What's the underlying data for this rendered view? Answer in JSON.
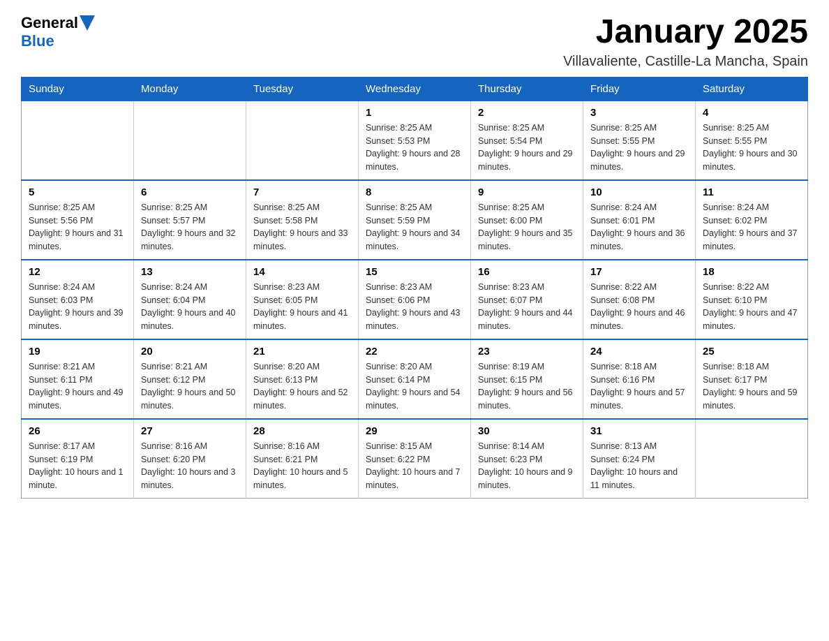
{
  "header": {
    "logo": {
      "text_general": "General",
      "text_blue": "Blue"
    },
    "title": "January 2025",
    "subtitle": "Villavaliente, Castille-La Mancha, Spain"
  },
  "calendar": {
    "days_of_week": [
      "Sunday",
      "Monday",
      "Tuesday",
      "Wednesday",
      "Thursday",
      "Friday",
      "Saturday"
    ],
    "weeks": [
      {
        "days": [
          {
            "number": "",
            "info": ""
          },
          {
            "number": "",
            "info": ""
          },
          {
            "number": "",
            "info": ""
          },
          {
            "number": "1",
            "info": "Sunrise: 8:25 AM\nSunset: 5:53 PM\nDaylight: 9 hours and 28 minutes."
          },
          {
            "number": "2",
            "info": "Sunrise: 8:25 AM\nSunset: 5:54 PM\nDaylight: 9 hours and 29 minutes."
          },
          {
            "number": "3",
            "info": "Sunrise: 8:25 AM\nSunset: 5:55 PM\nDaylight: 9 hours and 29 minutes."
          },
          {
            "number": "4",
            "info": "Sunrise: 8:25 AM\nSunset: 5:55 PM\nDaylight: 9 hours and 30 minutes."
          }
        ]
      },
      {
        "days": [
          {
            "number": "5",
            "info": "Sunrise: 8:25 AM\nSunset: 5:56 PM\nDaylight: 9 hours and 31 minutes."
          },
          {
            "number": "6",
            "info": "Sunrise: 8:25 AM\nSunset: 5:57 PM\nDaylight: 9 hours and 32 minutes."
          },
          {
            "number": "7",
            "info": "Sunrise: 8:25 AM\nSunset: 5:58 PM\nDaylight: 9 hours and 33 minutes."
          },
          {
            "number": "8",
            "info": "Sunrise: 8:25 AM\nSunset: 5:59 PM\nDaylight: 9 hours and 34 minutes."
          },
          {
            "number": "9",
            "info": "Sunrise: 8:25 AM\nSunset: 6:00 PM\nDaylight: 9 hours and 35 minutes."
          },
          {
            "number": "10",
            "info": "Sunrise: 8:24 AM\nSunset: 6:01 PM\nDaylight: 9 hours and 36 minutes."
          },
          {
            "number": "11",
            "info": "Sunrise: 8:24 AM\nSunset: 6:02 PM\nDaylight: 9 hours and 37 minutes."
          }
        ]
      },
      {
        "days": [
          {
            "number": "12",
            "info": "Sunrise: 8:24 AM\nSunset: 6:03 PM\nDaylight: 9 hours and 39 minutes."
          },
          {
            "number": "13",
            "info": "Sunrise: 8:24 AM\nSunset: 6:04 PM\nDaylight: 9 hours and 40 minutes."
          },
          {
            "number": "14",
            "info": "Sunrise: 8:23 AM\nSunset: 6:05 PM\nDaylight: 9 hours and 41 minutes."
          },
          {
            "number": "15",
            "info": "Sunrise: 8:23 AM\nSunset: 6:06 PM\nDaylight: 9 hours and 43 minutes."
          },
          {
            "number": "16",
            "info": "Sunrise: 8:23 AM\nSunset: 6:07 PM\nDaylight: 9 hours and 44 minutes."
          },
          {
            "number": "17",
            "info": "Sunrise: 8:22 AM\nSunset: 6:08 PM\nDaylight: 9 hours and 46 minutes."
          },
          {
            "number": "18",
            "info": "Sunrise: 8:22 AM\nSunset: 6:10 PM\nDaylight: 9 hours and 47 minutes."
          }
        ]
      },
      {
        "days": [
          {
            "number": "19",
            "info": "Sunrise: 8:21 AM\nSunset: 6:11 PM\nDaylight: 9 hours and 49 minutes."
          },
          {
            "number": "20",
            "info": "Sunrise: 8:21 AM\nSunset: 6:12 PM\nDaylight: 9 hours and 50 minutes."
          },
          {
            "number": "21",
            "info": "Sunrise: 8:20 AM\nSunset: 6:13 PM\nDaylight: 9 hours and 52 minutes."
          },
          {
            "number": "22",
            "info": "Sunrise: 8:20 AM\nSunset: 6:14 PM\nDaylight: 9 hours and 54 minutes."
          },
          {
            "number": "23",
            "info": "Sunrise: 8:19 AM\nSunset: 6:15 PM\nDaylight: 9 hours and 56 minutes."
          },
          {
            "number": "24",
            "info": "Sunrise: 8:18 AM\nSunset: 6:16 PM\nDaylight: 9 hours and 57 minutes."
          },
          {
            "number": "25",
            "info": "Sunrise: 8:18 AM\nSunset: 6:17 PM\nDaylight: 9 hours and 59 minutes."
          }
        ]
      },
      {
        "days": [
          {
            "number": "26",
            "info": "Sunrise: 8:17 AM\nSunset: 6:19 PM\nDaylight: 10 hours and 1 minute."
          },
          {
            "number": "27",
            "info": "Sunrise: 8:16 AM\nSunset: 6:20 PM\nDaylight: 10 hours and 3 minutes."
          },
          {
            "number": "28",
            "info": "Sunrise: 8:16 AM\nSunset: 6:21 PM\nDaylight: 10 hours and 5 minutes."
          },
          {
            "number": "29",
            "info": "Sunrise: 8:15 AM\nSunset: 6:22 PM\nDaylight: 10 hours and 7 minutes."
          },
          {
            "number": "30",
            "info": "Sunrise: 8:14 AM\nSunset: 6:23 PM\nDaylight: 10 hours and 9 minutes."
          },
          {
            "number": "31",
            "info": "Sunrise: 8:13 AM\nSunset: 6:24 PM\nDaylight: 10 hours and 11 minutes."
          },
          {
            "number": "",
            "info": ""
          }
        ]
      }
    ]
  }
}
